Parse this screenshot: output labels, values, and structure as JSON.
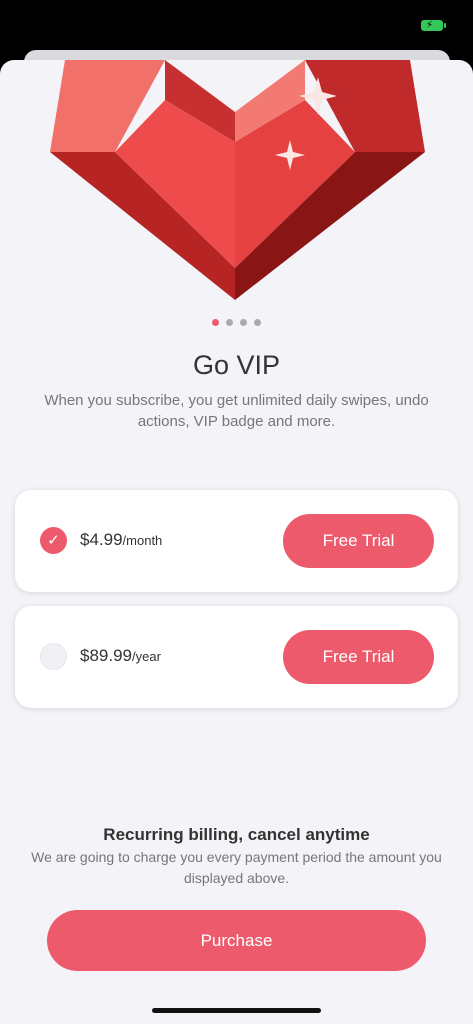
{
  "promo": {
    "title": "Go VIP",
    "subtitle": "When you subscribe, you get unlimited daily swipes, undo actions, VIP badge and more.",
    "carousel_active_index": 0,
    "carousel_count": 4
  },
  "plans": [
    {
      "amount": "$4.99",
      "period": "/month",
      "button_label": "Free Trial",
      "selected": true
    },
    {
      "amount": "$89.99",
      "period": "/year",
      "button_label": "Free Trial",
      "selected": false
    }
  ],
  "billing": {
    "title": "Recurring billing, cancel anytime",
    "text": "We are going to charge you every payment period the amount you displayed above."
  },
  "purchase_label": "Purchase",
  "icons": {
    "battery": "battery-charging-icon",
    "hero": "ruby-heart-illustration",
    "check": "checkmark-icon"
  },
  "colors": {
    "accent": "#ec5a6c",
    "background": "#f3f3f8",
    "battery": "#34c759"
  }
}
